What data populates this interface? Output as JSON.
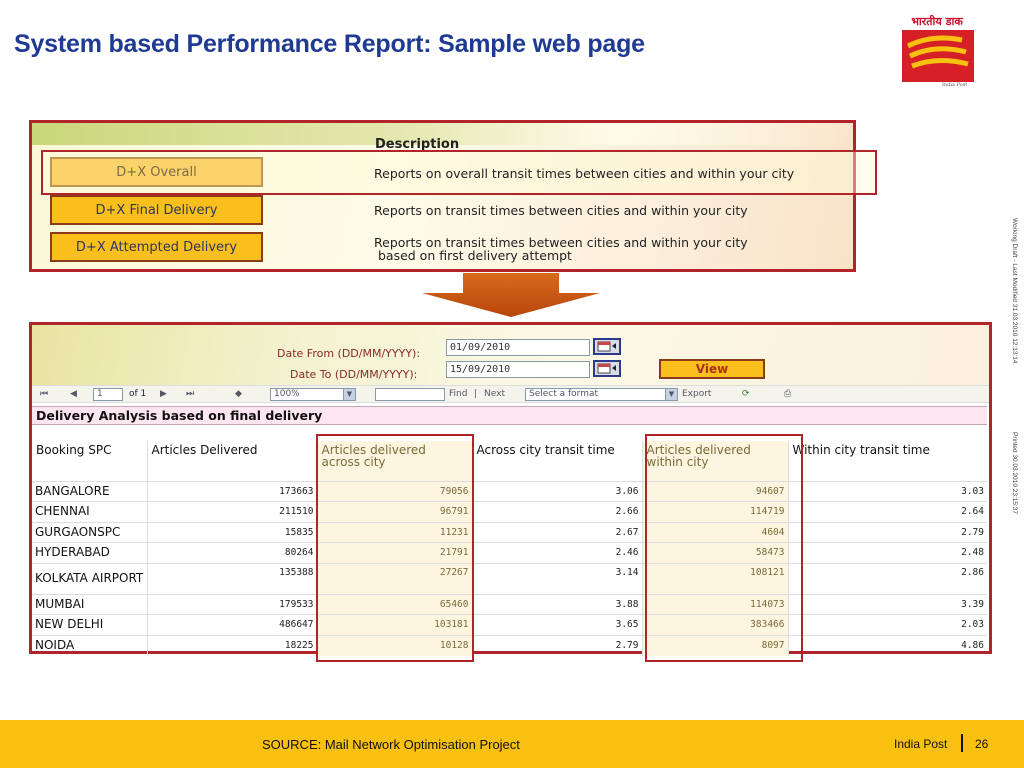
{
  "slide": {
    "title": "System based Performance Report: Sample web page",
    "logo_text_hindi": "भारतीय डाक",
    "logo_text_english": "India Post",
    "side_note_1": "Working Draft - Last Modified 31.03.2010 12:13:14",
    "side_note_2": "Printed 30.03.2010 23:15:37"
  },
  "report_list": {
    "description_header": "Description",
    "items": [
      {
        "label": "D+X Overall",
        "description": "Reports on overall transit times between cities and within your city"
      },
      {
        "label": "D+X Final Delivery",
        "description": "Reports on transit times between cities and within your city"
      },
      {
        "label": "D+X Attempted Delivery",
        "description_line1": "Reports on transit times between cities and within your city",
        "description_line2": " based on first delivery attempt"
      }
    ]
  },
  "filters": {
    "date_from_label": "Date From (DD/MM/YYYY):",
    "date_from_value": "01/09/2010",
    "date_to_label": "Date To (DD/MM/YYYY):",
    "date_to_value": "15/09/2010",
    "view_label": "View"
  },
  "toolbar": {
    "page_value": "1",
    "of_pages": "of 1",
    "zoom": "100%",
    "find": "Find",
    "sep": "|",
    "next": "Next",
    "format": "Select a format",
    "export": "Export"
  },
  "report": {
    "title": "Delivery Analysis based on final delivery",
    "columns": [
      "Booking SPC",
      "Articles Delivered",
      "Articles delivered across city",
      "Across city transit time",
      "Articles delivered within city",
      "Within city transit time"
    ],
    "rows": [
      [
        "BANGALORE",
        "173663",
        "79056",
        "3.06",
        "94607",
        "3.03"
      ],
      [
        "CHENNAI",
        "211510",
        "96791",
        "2.66",
        "114719",
        "2.64"
      ],
      [
        "GURGAONSPC",
        "15835",
        "11231",
        "2.67",
        "4604",
        "2.79"
      ],
      [
        "HYDERABAD",
        "80264",
        "21791",
        "2.46",
        "58473",
        "2.48"
      ],
      [
        "KOLKATA AIRPORT",
        "135388",
        "27267",
        "3.14",
        "108121",
        "2.86"
      ],
      [
        "MUMBAI",
        "179533",
        "65460",
        "3.88",
        "114073",
        "3.39"
      ],
      [
        "NEW DELHI",
        "486647",
        "103181",
        "3.65",
        "383466",
        "2.03"
      ],
      [
        "NOIDA",
        "18225",
        "10128",
        "2.79",
        "8097",
        "4.86"
      ]
    ]
  },
  "footer": {
    "source": "SOURCE: Mail Network Optimisation Project",
    "org": "India Post",
    "page": "26"
  },
  "colors": {
    "title_blue": "#1f3a93",
    "frame_red": "#b0242a",
    "button_yellow": "#f9c01d",
    "footer_yellow": "#f8c10f",
    "arrow_orange": "#c85410"
  }
}
